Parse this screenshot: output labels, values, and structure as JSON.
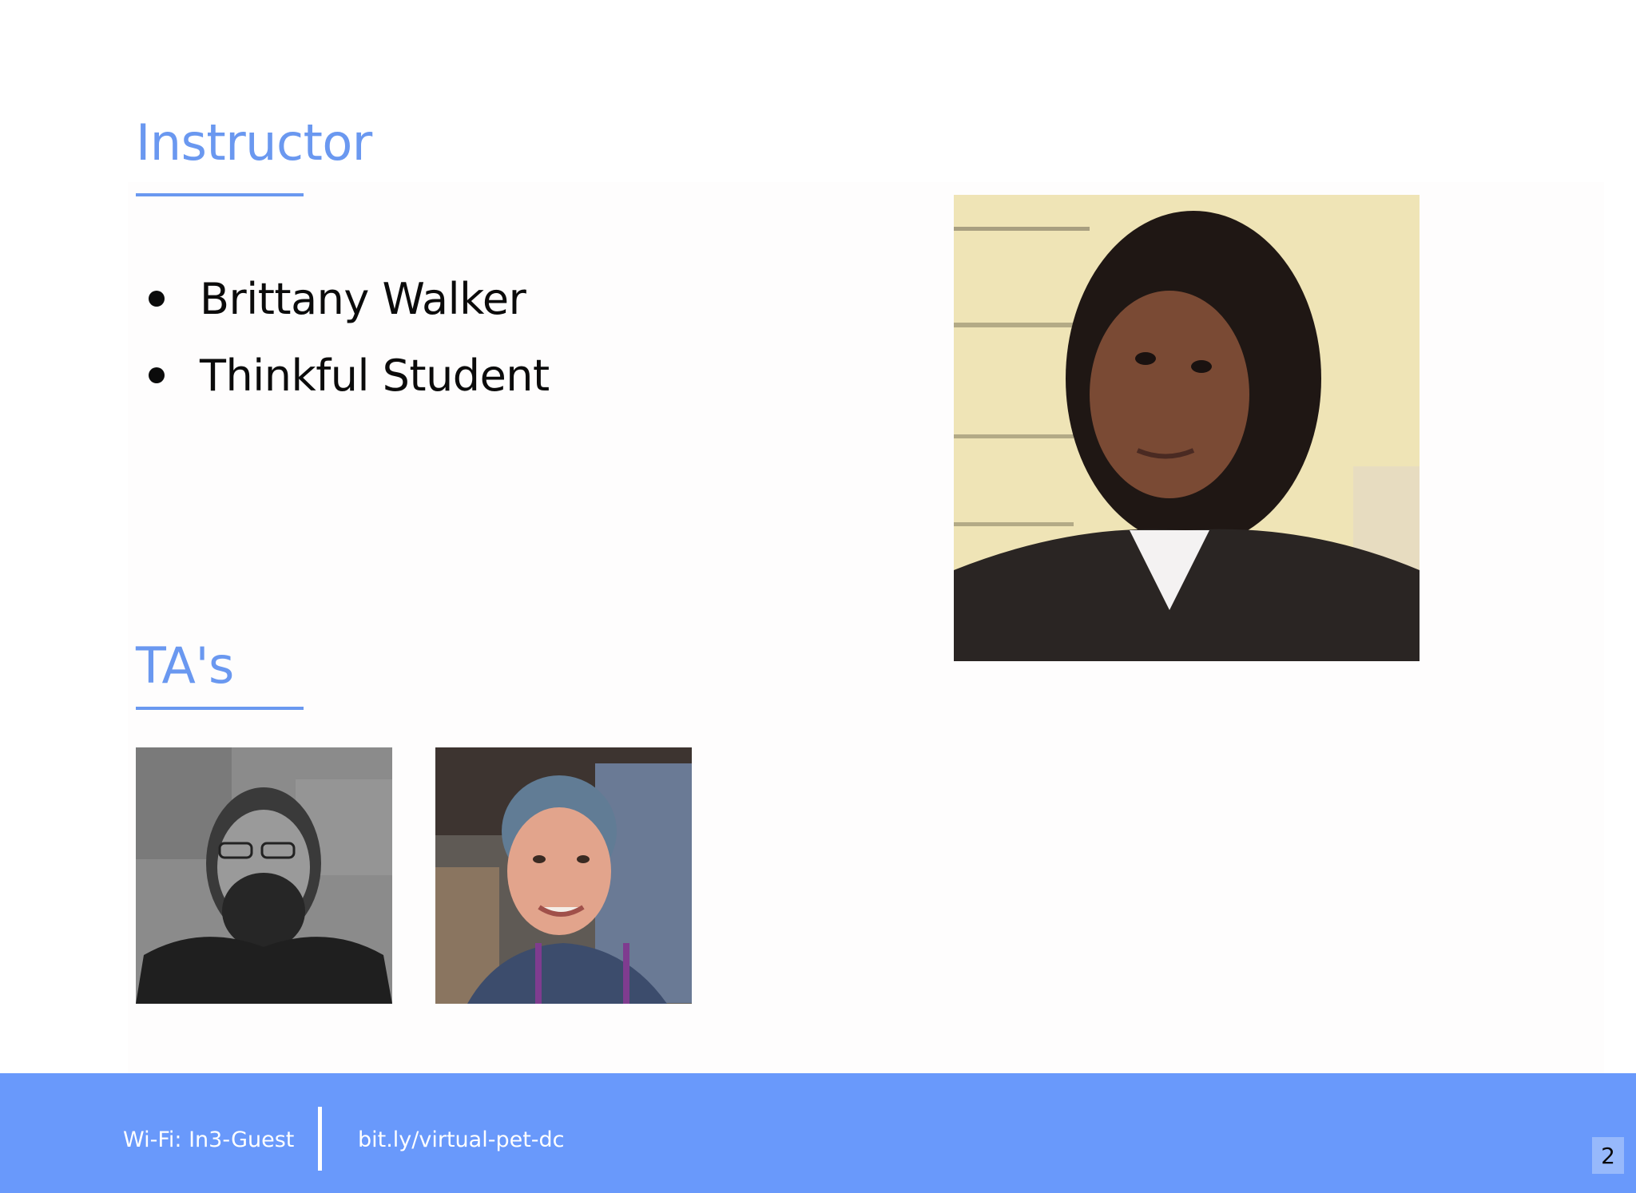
{
  "instructor": {
    "heading": "Instructor",
    "items": [
      "Brittany Walker",
      "Thinkful Student"
    ]
  },
  "tas": {
    "heading": "TA's"
  },
  "footer": {
    "wifi": "Wi-Fi: In3-Guest",
    "link": "bit.ly/virtual-pet-dc",
    "page_number": "2"
  },
  "colors": {
    "accent": "#6a98f0",
    "footer_bg": "#6999fb",
    "text": "#0b0b0b"
  }
}
